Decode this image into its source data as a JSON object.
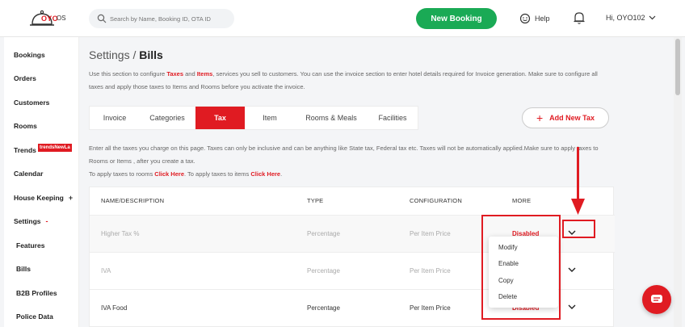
{
  "header": {
    "logo_text": "OYO",
    "logo_sub": "OS",
    "search_placeholder": "Search by Name, Booking ID, OTA ID",
    "new_booking_label": "New Booking",
    "help_label": "Help",
    "user_label": "Hi, OYO102"
  },
  "sidebar": {
    "items": [
      {
        "label": "Bookings"
      },
      {
        "label": "Orders"
      },
      {
        "label": "Customers"
      },
      {
        "label": "Rooms"
      },
      {
        "label": "Trends",
        "badge": "trendsNewLa"
      },
      {
        "label": "Calendar"
      },
      {
        "label": "House Keeping",
        "toggle": "+"
      },
      {
        "label": "Settings",
        "toggle": "-"
      },
      {
        "label": "Features"
      },
      {
        "label": "Bills"
      },
      {
        "label": "B2B Profiles"
      },
      {
        "label": "Police Data"
      }
    ]
  },
  "page": {
    "title_prefix": "Settings / ",
    "title_main": "Bills",
    "intro_1": "Use this section to configure ",
    "intro_taxes": "Taxes",
    "intro_and": " and ",
    "intro_items": "Items",
    "intro_2": ", services you sell to customers. You can use the invoice section to enter hotel details required for Invoice generation. Make sure to configure all taxes and apply those taxes to Items and Rooms before you activate the invoice."
  },
  "tabs": [
    {
      "label": "Invoice"
    },
    {
      "label": "Categories"
    },
    {
      "label": "Tax",
      "active": true
    },
    {
      "label": "Item"
    },
    {
      "label": "Rooms & Meals"
    },
    {
      "label": "Facilities"
    }
  ],
  "add_tax_label": "Add New Tax",
  "tax_note": {
    "line1": "Enter all the taxes you charge on this page. Taxes can only be inclusive and can be anything like State tax, Federal tax etc. Taxes will not be automatically applied.Make sure to apply taxes to Rooms or Items , after you create a tax.",
    "line2_prefix": "To apply taxes to rooms ",
    "click_here_1": "Click Here",
    "line2_mid": ". To apply taxes to items ",
    "click_here_2": "Click Here",
    "line2_end": "."
  },
  "table": {
    "headers": [
      "NAME/DESCRIPTION",
      "TYPE",
      "CONFIGURATION",
      "MORE"
    ],
    "rows": [
      {
        "name": "Higher Tax %",
        "type": "Percentage",
        "config": "Per Item Price",
        "status": "Disabled"
      },
      {
        "name": "IVA",
        "type": "Percentage",
        "config": "Per Item Price",
        "status": ""
      },
      {
        "name": "IVA Food",
        "type": "Percentage",
        "config": "Per Item Price",
        "status": "Disabled"
      }
    ]
  },
  "menu": {
    "items": [
      "Modify",
      "Enable",
      "Copy",
      "Delete"
    ]
  },
  "colors": {
    "brand_red": "#e01b22",
    "new_booking_green": "#1aaa55"
  }
}
